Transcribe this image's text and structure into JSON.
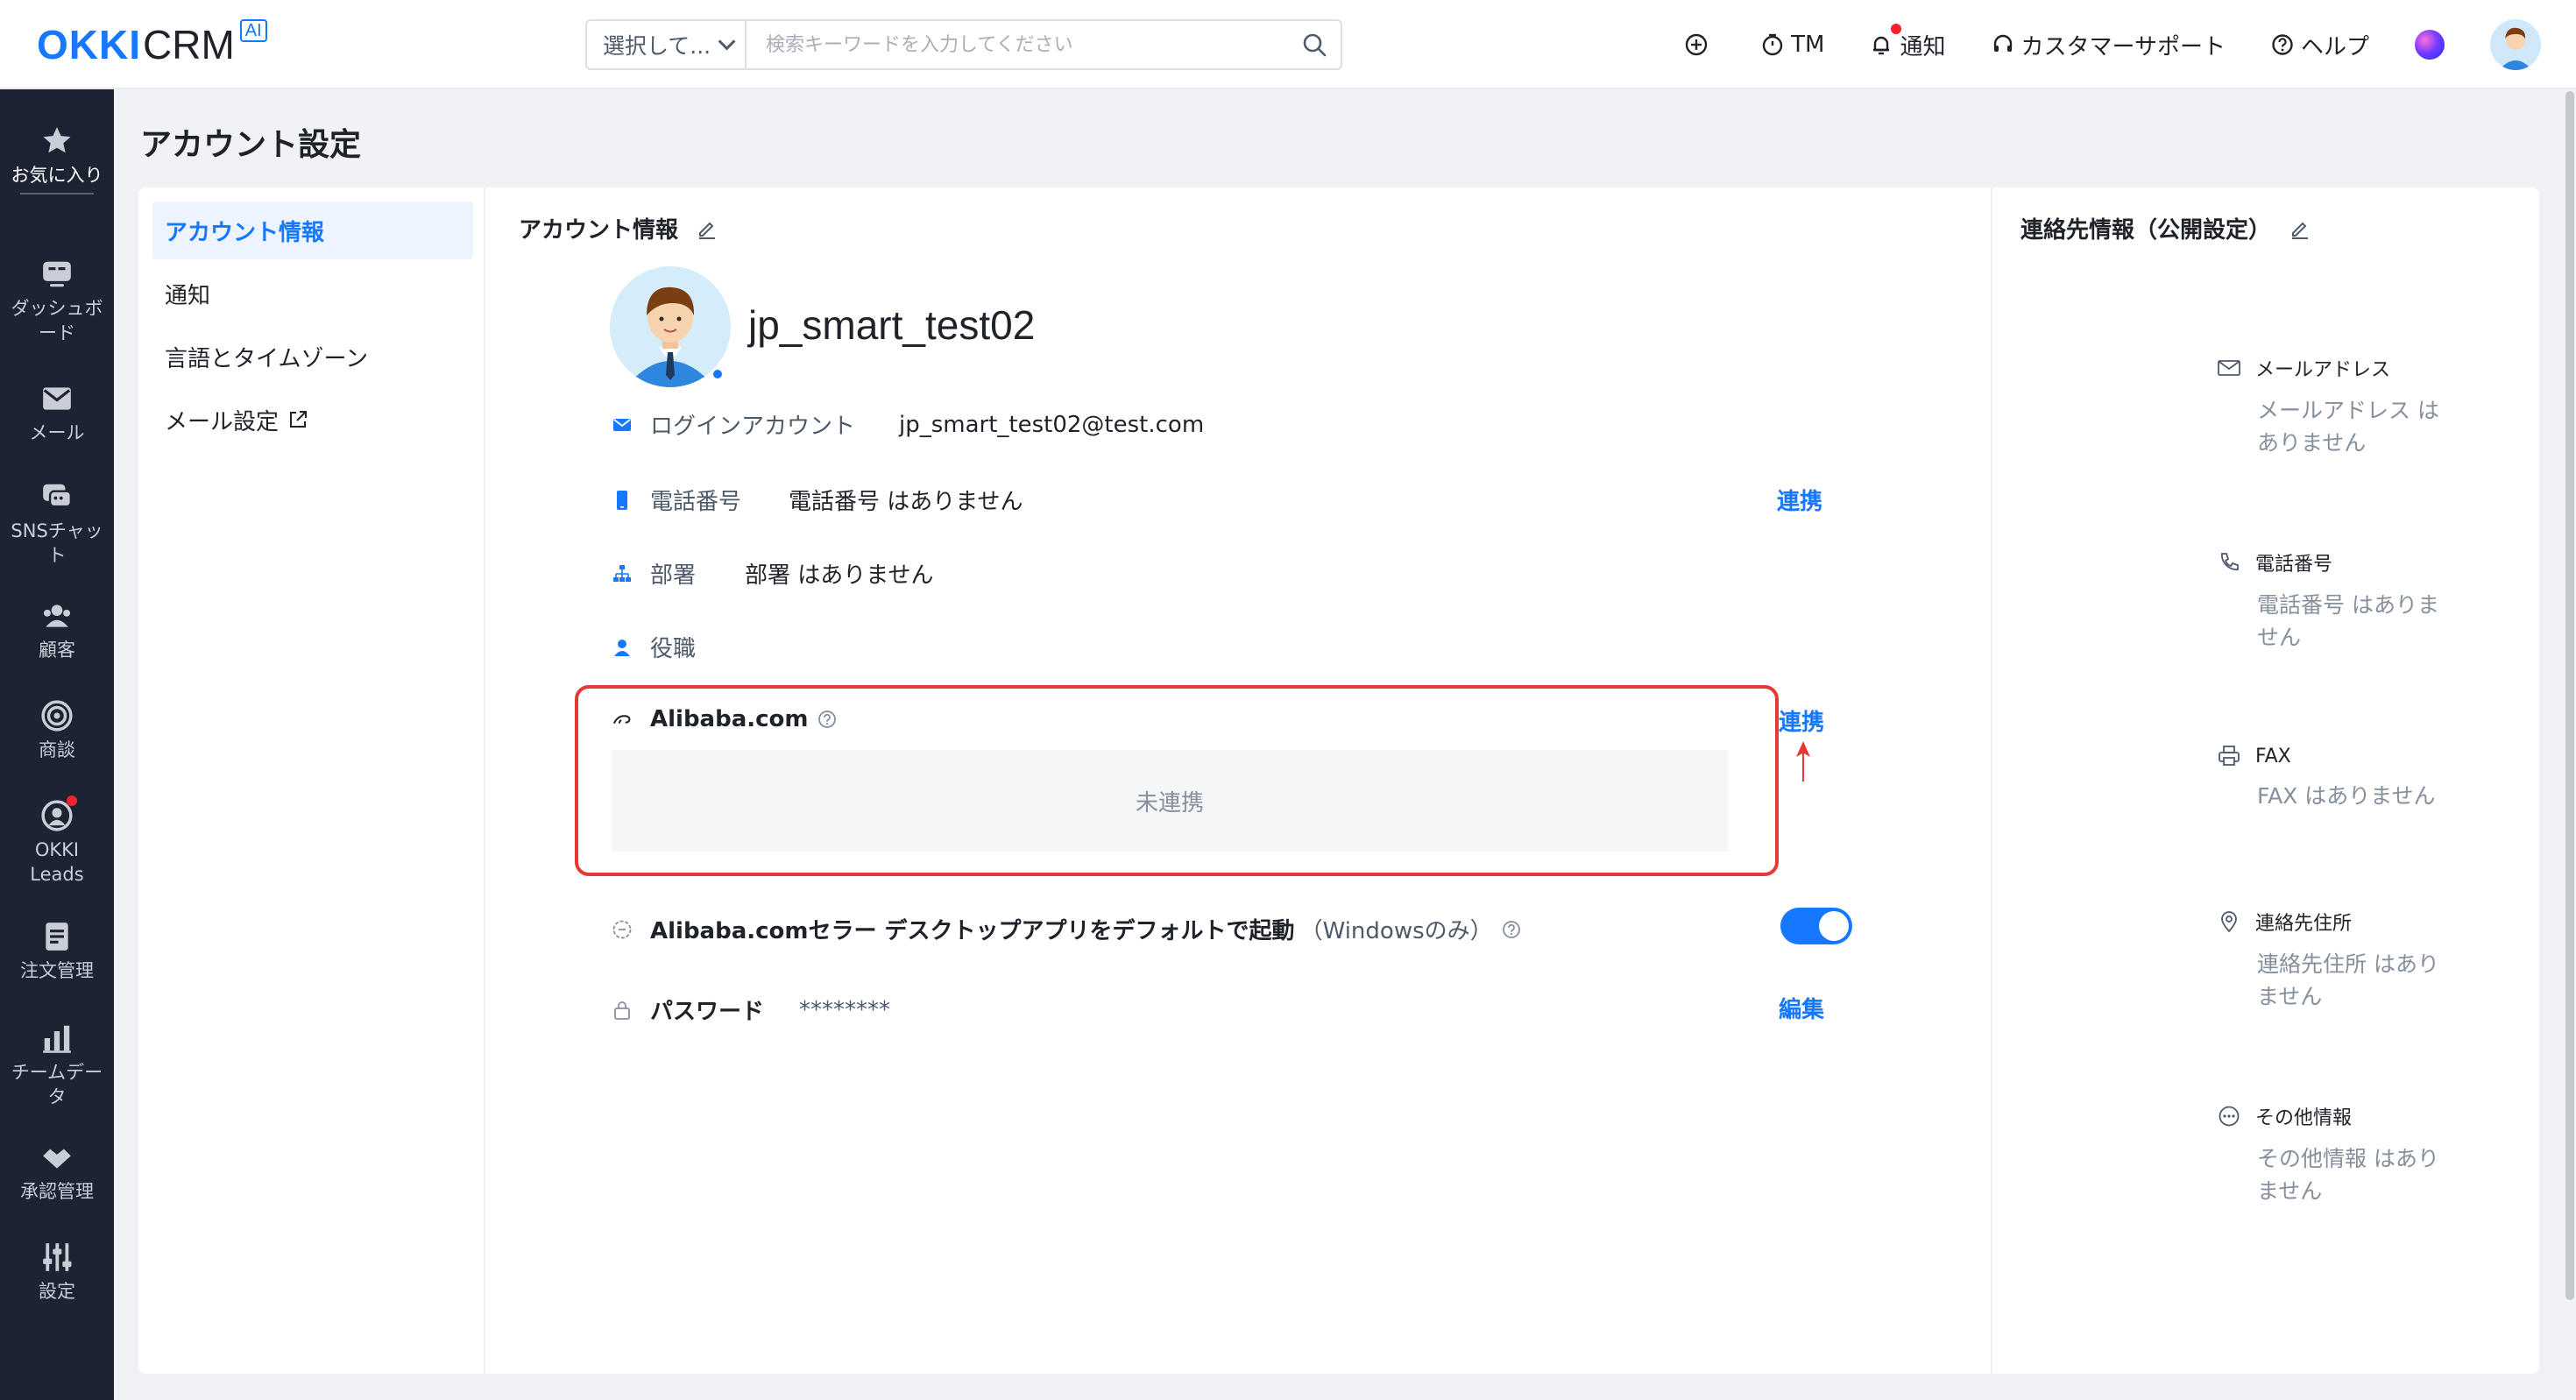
{
  "brand": {
    "logo_main": "OKKI",
    "logo_sub": "CRM",
    "logo_badge": "AI"
  },
  "search": {
    "select_label": "選択して...",
    "placeholder": "検索キーワードを入力してください"
  },
  "topnav": {
    "tm": "TM",
    "notify": "通知",
    "support": "カスタマーサポート",
    "help": "ヘルプ"
  },
  "sidebar": {
    "items": [
      {
        "label": "お気に入り",
        "icon": "star-icon"
      },
      {
        "label": "ダッシュボード",
        "icon": "dashboard-icon"
      },
      {
        "label": "メール",
        "icon": "mail-icon"
      },
      {
        "label": "SNSチャット",
        "icon": "chat-icon"
      },
      {
        "label": "顧客",
        "icon": "customers-icon"
      },
      {
        "label": "商談",
        "icon": "target-icon"
      },
      {
        "label": "OKKI Leads",
        "icon": "leads-icon"
      },
      {
        "label": "注文管理",
        "icon": "order-icon"
      },
      {
        "label": "チームデータ",
        "icon": "chart-icon"
      },
      {
        "label": "承認管理",
        "icon": "approval-icon"
      },
      {
        "label": "設定",
        "icon": "settings-icon"
      }
    ]
  },
  "page": {
    "title": "アカウント設定"
  },
  "menu": {
    "items": [
      {
        "label": "アカウント情報"
      },
      {
        "label": "通知"
      },
      {
        "label": "言語とタイムゾーン"
      },
      {
        "label": "メール設定"
      }
    ]
  },
  "account": {
    "section_title": "アカウント情報",
    "username": "jp_smart_test02",
    "login_label": "ログインアカウント",
    "login_value": "jp_smart_test02@test.com",
    "phone_label": "電話番号",
    "phone_value": "電話番号 はありません",
    "phone_link": "連携",
    "dept_label": "部署",
    "dept_value": "部署 はありません",
    "role_label": "役職",
    "alibaba_label": "Alibaba.com",
    "alibaba_link": "連携",
    "alibaba_status": "未連携",
    "desktop_label": "Alibaba.comセラー デスクトップアプリをデフォルトで起動",
    "desktop_note": "（Windowsのみ）",
    "desktop_toggle": "on",
    "password_label": "パスワード",
    "password_value": "********",
    "password_link": "編集"
  },
  "contact": {
    "section_title": "連絡先情報（公開設定）",
    "items": [
      {
        "label": "メールアドレス",
        "value": "メールアドレス はありません",
        "icon": "envelope-icon"
      },
      {
        "label": "電話番号",
        "value": "電話番号 はありません",
        "icon": "phone-icon"
      },
      {
        "label": "FAX",
        "value": "FAX はありません",
        "icon": "fax-icon"
      },
      {
        "label": "連絡先住所",
        "value": "連絡先住所 はありません",
        "icon": "location-icon"
      },
      {
        "label": "その他情報",
        "value": "その他情報 はありません",
        "icon": "more-icon"
      }
    ]
  },
  "colors": {
    "accent": "#1677ff",
    "sidebar_bg": "#1c2333",
    "highlight": "#e53935"
  }
}
